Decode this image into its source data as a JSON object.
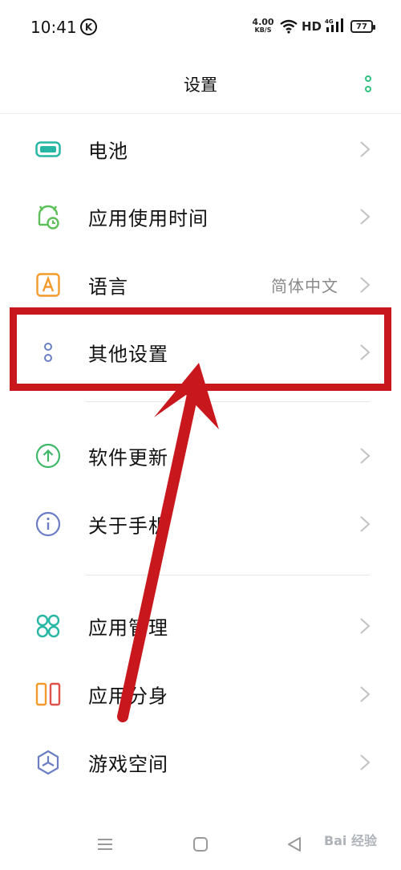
{
  "status_bar": {
    "time": "10:41",
    "k_icon_label": "K",
    "net_speed": "4.00",
    "net_unit": "KB/S",
    "hd": "HD",
    "network": "4G",
    "battery": "77"
  },
  "header": {
    "title": "设置"
  },
  "rows": [
    {
      "label": "电池",
      "icon": "battery-icon",
      "value": ""
    },
    {
      "label": "应用使用时间",
      "icon": "clock-timer-icon",
      "value": ""
    },
    {
      "label": "语言",
      "icon": "language-a-icon",
      "value": "简体中文"
    },
    {
      "label": "其他设置",
      "icon": "dots-icon",
      "value": ""
    },
    {
      "label": "软件更新",
      "icon": "upload-arrow-icon",
      "value": ""
    },
    {
      "label": "关于手机",
      "icon": "info-icon",
      "value": ""
    },
    {
      "label": "应用管理",
      "icon": "apps-grid-icon",
      "value": ""
    },
    {
      "label": "应用分身",
      "icon": "app-clone-icon",
      "value": ""
    },
    {
      "label": "游戏空间",
      "icon": "game-space-icon",
      "value": ""
    }
  ],
  "watermark": "Bai 经验",
  "colors": {
    "accent_green": "#2ec27e",
    "annotation_red": "#c8181e"
  }
}
